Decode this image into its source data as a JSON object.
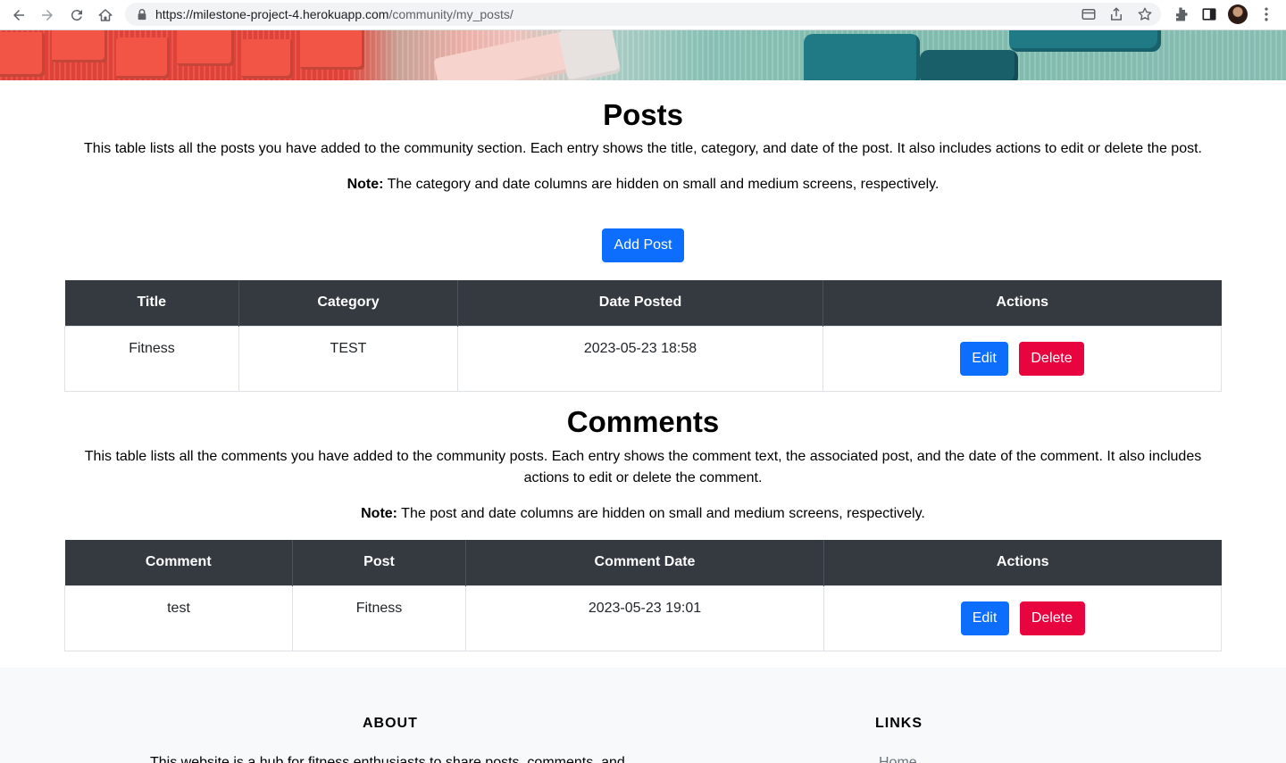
{
  "browser": {
    "url_host": "https://milestone-project-4.herokuapp.com",
    "url_path": "/community/my_posts/"
  },
  "posts": {
    "heading": "Posts",
    "description": "This table lists all the posts you have added to the community section. Each entry shows the title, category, and date of the post. It also includes actions to edit or delete the post.",
    "note_label": "Note:",
    "note_text": " The category and date columns are hidden on small and medium screens, respectively.",
    "add_button": "Add Post",
    "columns": [
      "Title",
      "Category",
      "Date Posted",
      "Actions"
    ],
    "rows": [
      {
        "title": "Fitness",
        "category": "TEST",
        "date": "2023-05-23 18:58",
        "edit": "Edit",
        "delete": "Delete"
      }
    ]
  },
  "comments": {
    "heading": "Comments",
    "description_line1": "This table lists all the comments you have added to the community posts. Each entry shows the comment text, the associated post, and the date of the comment. It also includes",
    "description_line2": "actions to edit or delete the comment.",
    "note_label": "Note:",
    "note_text": " The post and date columns are hidden on small and medium screens, respectively.",
    "columns": [
      "Comment",
      "Post",
      "Comment Date",
      "Actions"
    ],
    "rows": [
      {
        "comment": "test",
        "post": "Fitness",
        "date": "2023-05-23 19:01",
        "edit": "Edit",
        "delete": "Delete"
      }
    ]
  },
  "footer": {
    "about_heading": "ABOUT",
    "about_text": "This website is a hub for fitness enthusiasts to share posts, comments, and",
    "links_heading": "LINKS",
    "links": [
      "Home"
    ]
  },
  "colors": {
    "primary": "#0d6efd",
    "danger": "#e8053f",
    "table_header": "#343a40",
    "footer_bg": "#f8f9fa"
  }
}
